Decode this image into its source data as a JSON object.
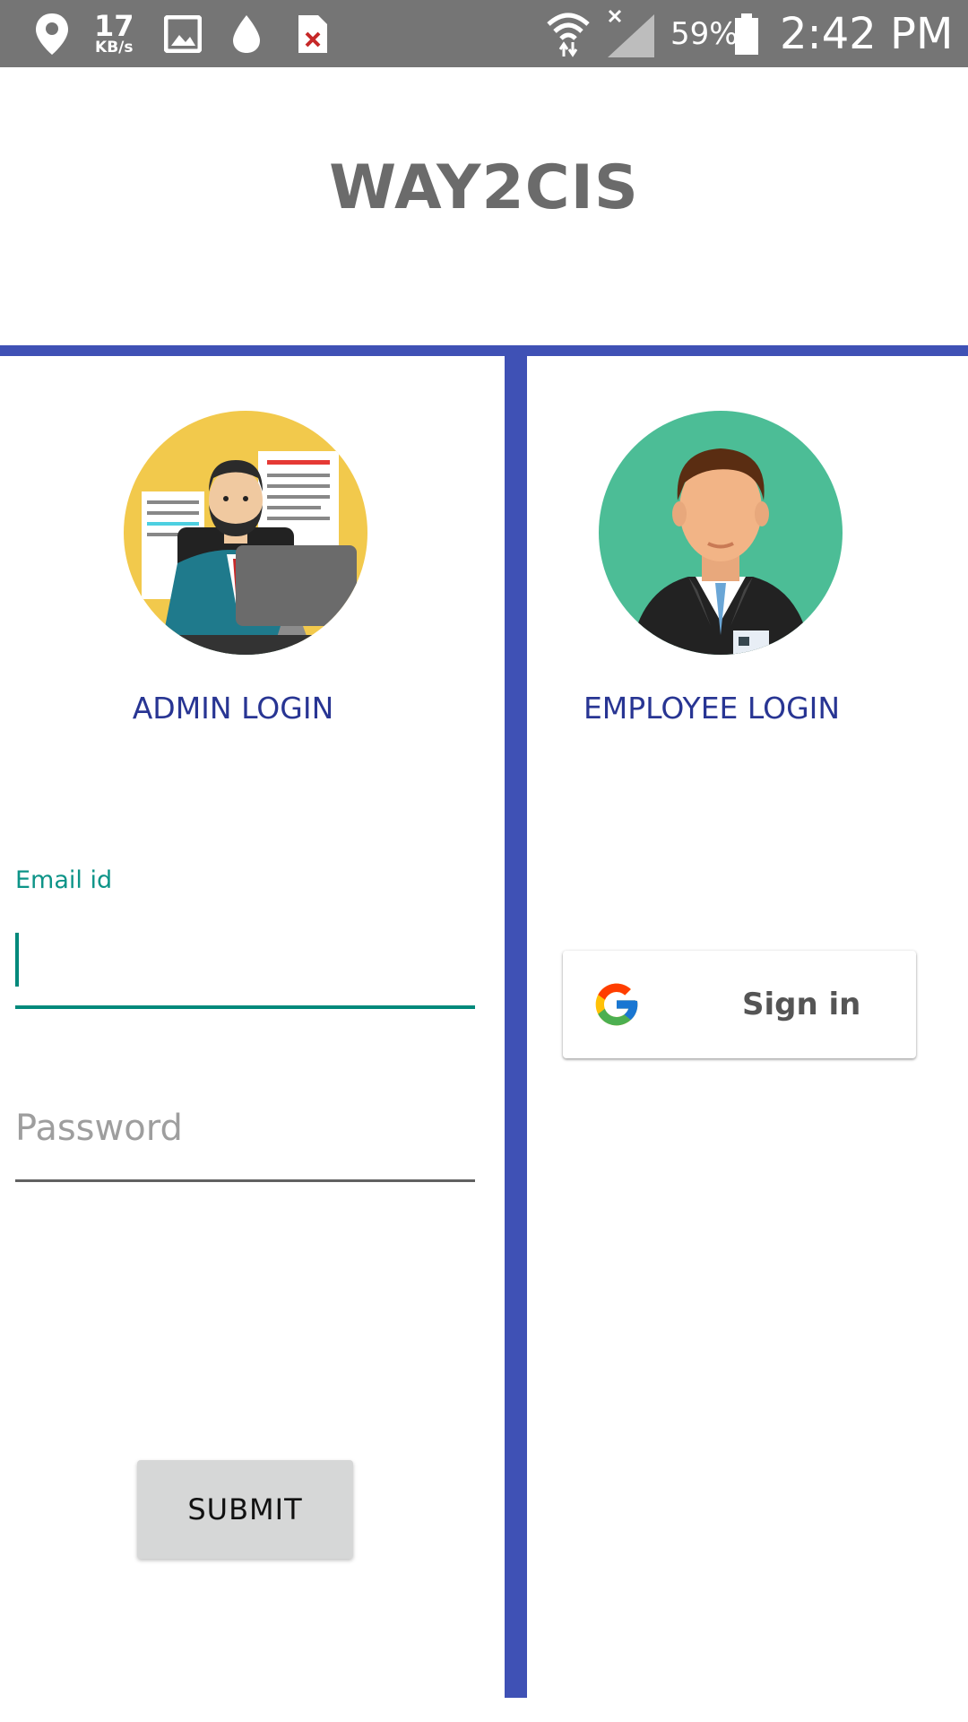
{
  "status_bar": {
    "net_speed": "17",
    "net_speed_unit": "KB/s",
    "battery_percent": "59%",
    "time": "2:42 PM",
    "icons": [
      "location-icon",
      "gallery-icon",
      "drop-icon",
      "file-error-icon",
      "wifi-icon",
      "signal-icon",
      "battery-icon"
    ]
  },
  "app": {
    "title": "WAY2CIS"
  },
  "admin": {
    "label": "ADMIN LOGIN",
    "email_label": "Email id",
    "email_value": "",
    "password_placeholder": "Password",
    "submit_label": "SUBMIT"
  },
  "employee": {
    "label": "EMPLOYEE LOGIN",
    "signin_label": "Sign in"
  },
  "colors": {
    "divider": "#3f51b5",
    "label_text": "#283593",
    "accent": "#00897b",
    "status_bar": "#757575"
  }
}
